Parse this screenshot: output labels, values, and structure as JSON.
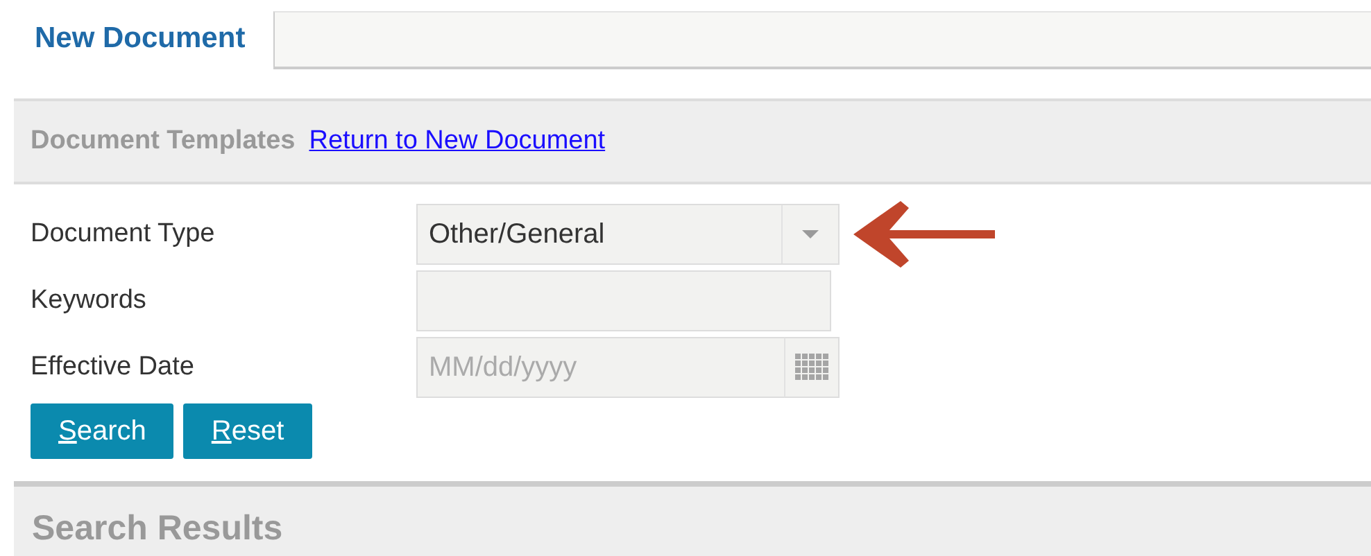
{
  "tab": {
    "label": "New Document",
    "selected": true
  },
  "templates": {
    "title": "Document Templates",
    "link": "Return to New Document"
  },
  "form": {
    "document_type": {
      "label": "Document Type",
      "value": "Other/General"
    },
    "keywords": {
      "label": "Keywords"
    },
    "effective_date": {
      "label": "Effective Date",
      "placeholder": "MM/dd/yyyy"
    }
  },
  "buttons": [
    {
      "mnemonic": "S",
      "rest": "earch"
    },
    {
      "mnemonic": "R",
      "rest": "eset"
    }
  ],
  "results": {
    "title": "Search Results"
  }
}
